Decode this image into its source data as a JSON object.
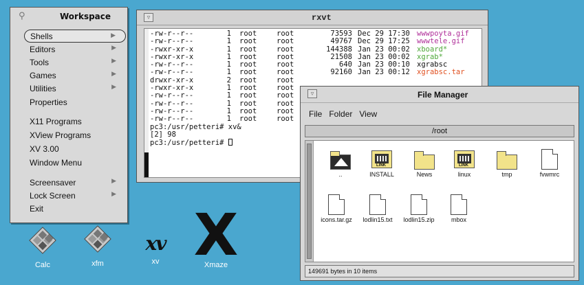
{
  "workspace": {
    "title": "Workspace",
    "items": [
      {
        "label": "Shells",
        "submenu": true,
        "selected": true
      },
      {
        "label": "Editors",
        "submenu": true
      },
      {
        "label": "Tools",
        "submenu": true
      },
      {
        "label": "Games",
        "submenu": true
      },
      {
        "label": "Utilities",
        "submenu": true
      },
      {
        "label": "Properties",
        "submenu": false
      },
      {
        "label": "X11 Programs",
        "submenu": false
      },
      {
        "label": "XView Programs",
        "submenu": false
      },
      {
        "label": "XV 3.00",
        "submenu": false
      },
      {
        "label": "Window Menu",
        "submenu": false
      },
      {
        "label": "Screensaver",
        "submenu": true
      },
      {
        "label": "Lock Screen",
        "submenu": true
      },
      {
        "label": "Exit",
        "submenu": false
      }
    ]
  },
  "rxvt": {
    "title": "rxvt",
    "listing": [
      {
        "perm": "-rw-r--r--",
        "links": "1",
        "owner": "root",
        "group": "root",
        "size": "73593",
        "date": "Dec 29 17:30",
        "name": "wwwpoyta.gif",
        "color": "#b0309a"
      },
      {
        "perm": "-rw-r--r--",
        "links": "1",
        "owner": "root",
        "group": "root",
        "size": "49767",
        "date": "Dec 29 17:25",
        "name": "wwwtele.gif",
        "color": "#b0309a"
      },
      {
        "perm": "-rwxr-xr-x",
        "links": "1",
        "owner": "root",
        "group": "root",
        "size": "144388",
        "date": "Jan 23 00:02",
        "name": "xboard*",
        "color": "#4fa83a"
      },
      {
        "perm": "-rwxr-xr-x",
        "links": "1",
        "owner": "root",
        "group": "root",
        "size": "21508",
        "date": "Jan 23 00:02",
        "name": "xgrab*",
        "color": "#4fa83a"
      },
      {
        "perm": "-rw-r--r--",
        "links": "1",
        "owner": "root",
        "group": "root",
        "size": "640",
        "date": "Jan 23 00:10",
        "name": "xgrabsc",
        "color": "#111111"
      },
      {
        "perm": "-rw-r--r--",
        "links": "1",
        "owner": "root",
        "group": "root",
        "size": "92160",
        "date": "Jan 23 00:12",
        "name": "xgrabsc.tar",
        "color": "#e05020"
      },
      {
        "perm": "drwxr-xr-x",
        "links": "2",
        "owner": "root",
        "group": "root",
        "size": "",
        "date": "",
        "name": "",
        "color": "#111111"
      },
      {
        "perm": "-rwxr-xr-x",
        "links": "1",
        "owner": "root",
        "group": "root",
        "size": "",
        "date": "",
        "name": "",
        "color": "#111111"
      },
      {
        "perm": "-rw-r--r--",
        "links": "1",
        "owner": "root",
        "group": "root",
        "size": "",
        "date": "",
        "name": "",
        "color": "#111111"
      },
      {
        "perm": "-rw-r--r--",
        "links": "1",
        "owner": "root",
        "group": "root",
        "size": "",
        "date": "",
        "name": "",
        "color": "#111111"
      },
      {
        "perm": "-rw-r--r--",
        "links": "1",
        "owner": "root",
        "group": "root",
        "size": "",
        "date": "",
        "name": "",
        "color": "#111111"
      },
      {
        "perm": "-rw-r--r--",
        "links": "1",
        "owner": "root",
        "group": "root",
        "size": "",
        "date": "",
        "name": "",
        "color": "#111111"
      }
    ],
    "prompt_lines": [
      "pc3:/usr/petteri# xv&",
      "[2] 98",
      "pc3:/usr/petteri# "
    ]
  },
  "file_manager": {
    "title": "File Manager",
    "menus": [
      "File",
      "Folder",
      "View"
    ],
    "path": "/root",
    "items": [
      {
        "label": "..",
        "icon": "parent-folder-icon"
      },
      {
        "label": "INSTALL",
        "icon": "link-icon"
      },
      {
        "label": "News",
        "icon": "folder-icon"
      },
      {
        "label": "linux",
        "icon": "link-icon"
      },
      {
        "label": "tmp",
        "icon": "folder-icon"
      },
      {
        "label": "fvwmrc",
        "icon": "document-icon"
      },
      {
        "label": "icons.tar.gz",
        "icon": "document-icon"
      },
      {
        "label": "lodlin15.txt",
        "icon": "document-icon"
      },
      {
        "label": "lodlin15.zip",
        "icon": "document-icon"
      },
      {
        "label": "mbox",
        "icon": "document-icon"
      }
    ],
    "status": "149691 bytes in 10 items"
  },
  "desktop": {
    "icons": [
      {
        "label": "Calc"
      },
      {
        "label": "xfm"
      },
      {
        "label": "xv",
        "logo": "xv"
      },
      {
        "label": "Xmaze",
        "logo": "X"
      }
    ]
  }
}
